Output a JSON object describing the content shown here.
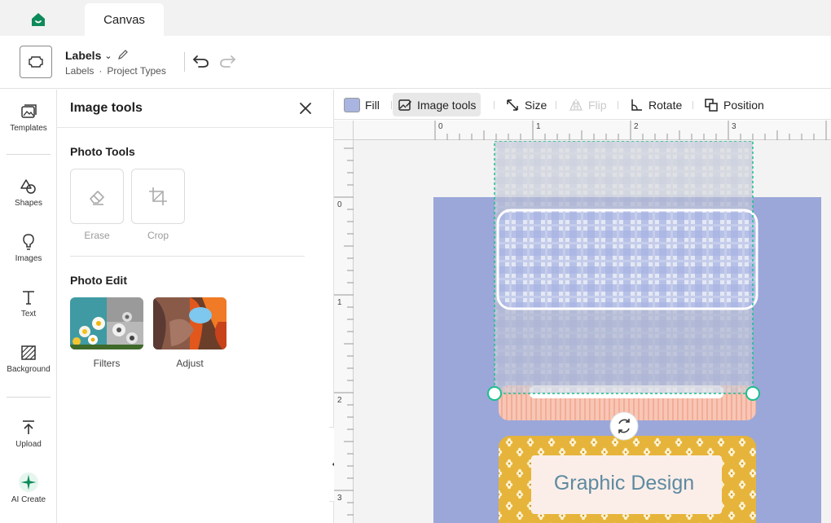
{
  "tabs": {
    "active": "Canvas"
  },
  "project": {
    "title": "Labels",
    "crumb_1": "Labels",
    "crumb_sep": "·",
    "crumb_2": "Project Types"
  },
  "rail": {
    "templates": "Templates",
    "shapes": "Shapes",
    "images": "Images",
    "text": "Text",
    "background": "Background",
    "upload": "Upload",
    "ai_create": "AI Create"
  },
  "panel": {
    "title": "Image tools",
    "photo_tools_heading": "Photo Tools",
    "erase": "Erase",
    "crop": "Crop",
    "photo_edit_heading": "Photo Edit",
    "filters": "Filters",
    "adjust": "Adjust"
  },
  "toolbar": {
    "fill": "Fill",
    "image_tools": "Image tools",
    "size": "Size",
    "flip": "Flip",
    "rotate": "Rotate",
    "position": "Position"
  },
  "rulers": {
    "h": [
      "0",
      "1",
      "2",
      "3"
    ],
    "v": [
      "0",
      "1",
      "2",
      "3"
    ]
  },
  "canvas": {
    "label_text": "Graphic Design"
  },
  "colors": {
    "brand": "#0d8a5a",
    "label_bg": "#9ba7d9",
    "gingham": "#a8b4e3",
    "peach": "#f7bfae",
    "mustard": "#e6b43a",
    "selection": "#1cbf8e"
  }
}
